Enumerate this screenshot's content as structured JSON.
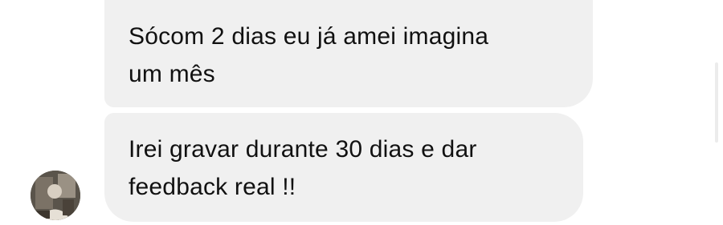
{
  "conversation": {
    "messages": [
      {
        "lines": [
          "Sócom 2 dias eu já amei imagina",
          "um mês"
        ]
      },
      {
        "lines": [
          "Irei gravar durante 30 dias e dar",
          "feedback real !!"
        ]
      }
    ]
  },
  "avatar": {
    "icon": "user-avatar-photo"
  },
  "colors": {
    "bubble_background": "#f0f0f0",
    "text": "#111111",
    "page_background": "#ffffff"
  }
}
